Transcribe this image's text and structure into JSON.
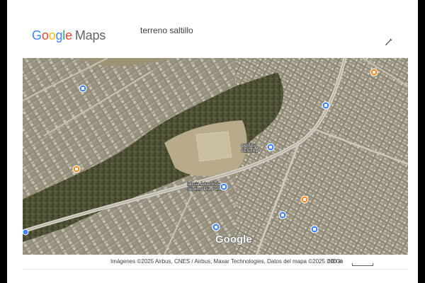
{
  "header": {
    "logo_parts": [
      "G",
      "o",
      "o",
      "g",
      "l",
      "e"
    ],
    "logo_suffix": "Maps",
    "query": "terreno saltillo"
  },
  "map": {
    "labels": {
      "place_1_line1": "QUINTA",
      "place_1_line2": "CENTRO",
      "place_2_line1": "Iglesia Adventista",
      "place_2_line2": "Séptimo Día Centro"
    },
    "watermark": "Google",
    "pins": [
      {
        "type": "blue"
      },
      {
        "type": "blue"
      },
      {
        "type": "blue"
      },
      {
        "type": "blue"
      },
      {
        "type": "orange"
      },
      {
        "type": "orange"
      },
      {
        "type": "orange"
      }
    ]
  },
  "footer": {
    "attribution": "Imágenes ©2025 Airbus, CNES / Airbus, Maxar Technologies, Datos del mapa ©2025 INEGI",
    "scale_label": "100 m"
  },
  "colors": {
    "blue_pin": "#4285F4",
    "orange_pin": "#F28B20"
  },
  "icons": {
    "edit": "pencil-icon"
  }
}
